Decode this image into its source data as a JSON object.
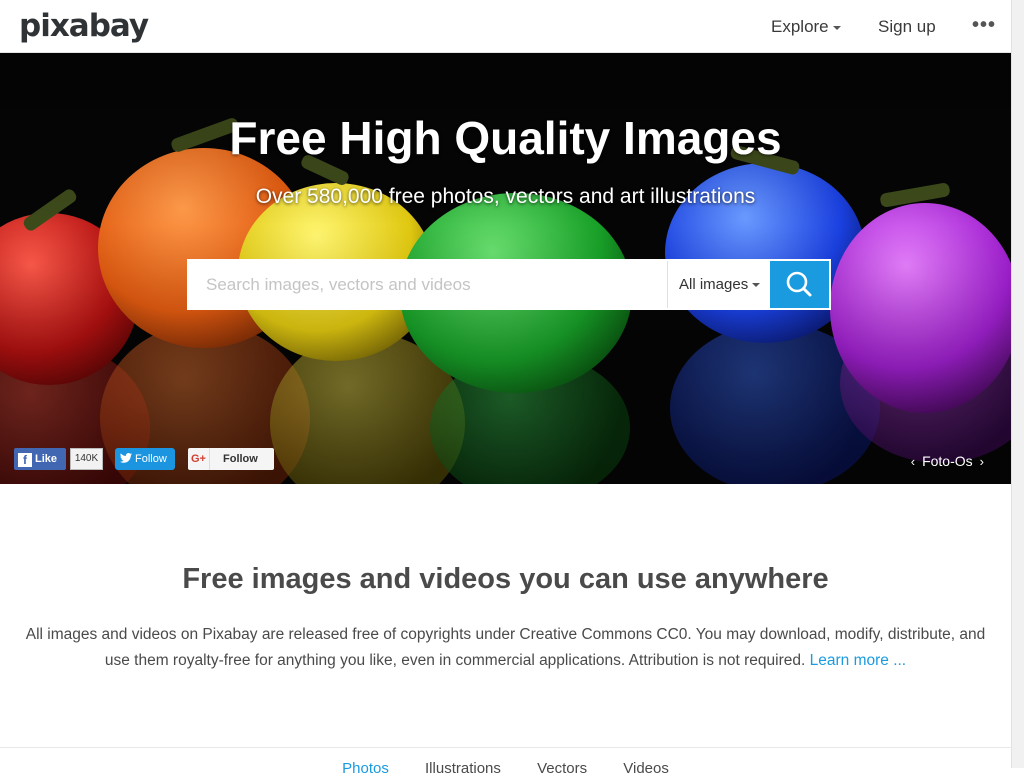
{
  "header": {
    "logo": "pixabay",
    "explore_label": "Explore",
    "signup_label": "Sign up",
    "more_label": "•••"
  },
  "hero": {
    "title": "Free High Quality Images",
    "subtitle": "Over 580,000 free photos, vectors and art illustrations",
    "search": {
      "placeholder": "Search images, vectors and videos",
      "value": "",
      "type_selected": "All images"
    },
    "social": {
      "fb_label": "Like",
      "fb_count": "140K",
      "twitter_label": "Follow",
      "gplus_label": "Follow"
    },
    "credit": "Foto-Os",
    "credit_prev": "‹",
    "credit_next": "›"
  },
  "intro": {
    "title": "Free images and videos you can use anywhere",
    "text": "All images and videos on Pixabay are released free of copyrights under Creative Commons CC0. You may download, modify, distribute, and use them royalty-free for anything you like, even in commercial applications. Attribution is not required.",
    "link": "Learn more ..."
  },
  "tabs": [
    {
      "label": "Photos"
    },
    {
      "label": "Illustrations"
    },
    {
      "label": "Vectors"
    },
    {
      "label": "Videos"
    }
  ],
  "colors": {
    "accent": "#1a9be0",
    "text": "#4a4a4a",
    "facebook": "#4267b2",
    "twitter": "#1b95e0"
  }
}
